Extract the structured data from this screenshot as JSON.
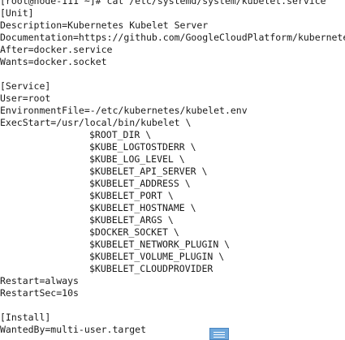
{
  "terminal": {
    "lines": [
      {
        "text": "[root@node-111 ~]# cat /etc/systemd/system/kubelet.service",
        "indent": false
      },
      {
        "text": "[Unit]",
        "indent": false
      },
      {
        "text": "Description=Kubernetes Kubelet Server",
        "indent": false
      },
      {
        "text": "Documentation=https://github.com/GoogleCloudPlatform/kubernetes",
        "indent": false
      },
      {
        "text": "After=docker.service",
        "indent": false
      },
      {
        "text": "Wants=docker.socket",
        "indent": false
      },
      {
        "text": "",
        "indent": false
      },
      {
        "text": "[Service]",
        "indent": false
      },
      {
        "text": "User=root",
        "indent": false
      },
      {
        "text": "EnvironmentFile=-/etc/kubernetes/kubelet.env",
        "indent": false
      },
      {
        "text": "ExecStart=/usr/local/bin/kubelet \\",
        "indent": false
      },
      {
        "text": "$ROOT_DIR \\",
        "indent": true
      },
      {
        "text": "$KUBE_LOGTOSTDERR \\",
        "indent": true
      },
      {
        "text": "$KUBE_LOG_LEVEL \\",
        "indent": true
      },
      {
        "text": "$KUBELET_API_SERVER \\",
        "indent": true
      },
      {
        "text": "$KUBELET_ADDRESS \\",
        "indent": true
      },
      {
        "text": "$KUBELET_PORT \\",
        "indent": true
      },
      {
        "text": "$KUBELET_HOSTNAME \\",
        "indent": true
      },
      {
        "text": "$KUBELET_ARGS \\",
        "indent": true
      },
      {
        "text": "$DOCKER_SOCKET \\",
        "indent": true
      },
      {
        "text": "$KUBELET_NETWORK_PLUGIN \\",
        "indent": true
      },
      {
        "text": "$KUBELET_VOLUME_PLUGIN \\",
        "indent": true
      },
      {
        "text": "$KUBELET_CLOUDPROVIDER",
        "indent": true
      },
      {
        "text": "Restart=always",
        "indent": false
      },
      {
        "text": "RestartSec=10s",
        "indent": false
      },
      {
        "text": "",
        "indent": false
      },
      {
        "text": "[Install]",
        "indent": false
      },
      {
        "text": "WantedBy=multi-user.target",
        "indent": false
      }
    ]
  },
  "taskbar": {
    "icon": "window-icon",
    "color": "#6fa8dc"
  }
}
